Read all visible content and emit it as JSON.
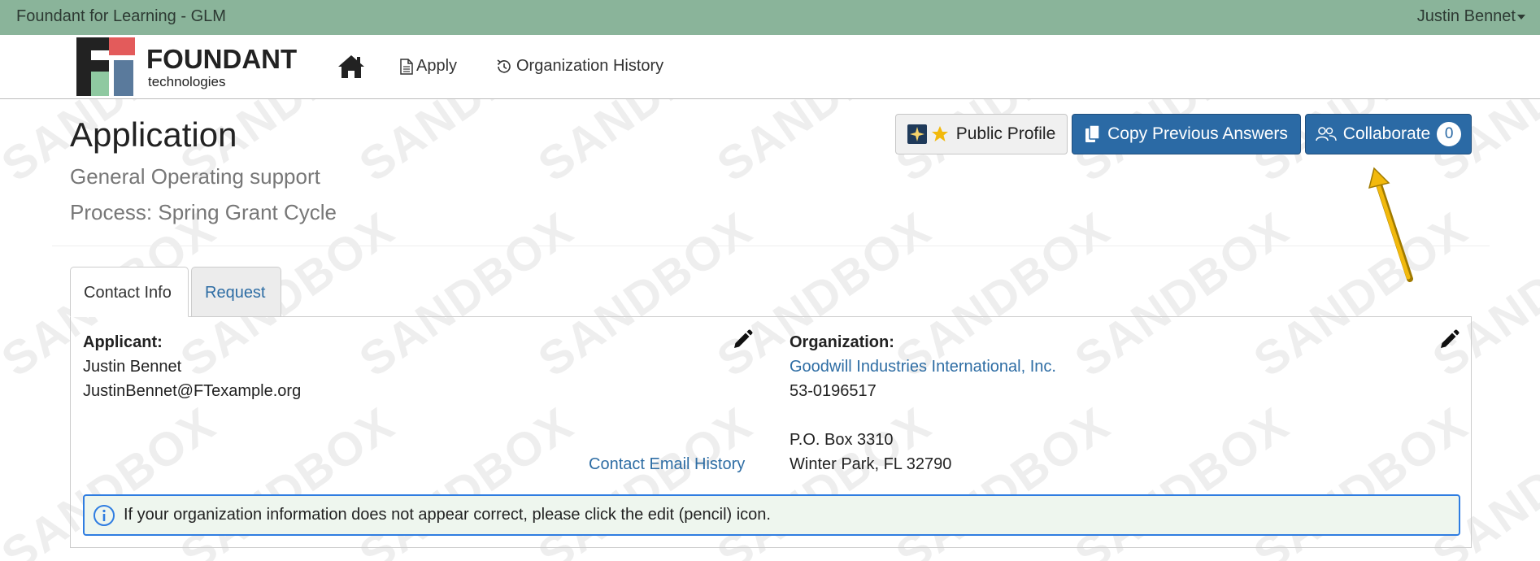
{
  "topbar": {
    "site_title": "Foundant for Learning - GLM",
    "user_name": "Justin Bennet"
  },
  "logo": {
    "name": "FOUNDANT",
    "tagline": "technologies"
  },
  "nav": {
    "home_icon": "home-icon",
    "apply_label": "Apply",
    "history_label": "Organization History"
  },
  "page": {
    "title": "Application",
    "subtitle": "General Operating support",
    "process": "Process: Spring Grant Cycle"
  },
  "actions": {
    "public_profile_label": "Public Profile",
    "copy_previous_label": "Copy Previous Answers",
    "collaborate_label": "Collaborate",
    "collaborate_count": "0"
  },
  "tabs": [
    {
      "label": "Contact Info",
      "active": true
    },
    {
      "label": "Request",
      "active": false
    }
  ],
  "applicant": {
    "label": "Applicant:",
    "name": "Justin Bennet",
    "email": "JustinBennet@FTexample.org",
    "email_history_link": "Contact Email History"
  },
  "organization": {
    "label": "Organization:",
    "name": "Goodwill Industries International, Inc.",
    "ein": "53-0196517",
    "address_line1": "P.O. Box 3310",
    "address_line2": "Winter Park, FL 32790"
  },
  "alert": {
    "message": "If your organization information does not appear correct, please click the edit (pencil) icon."
  },
  "watermark": "SANDBOX",
  "colors": {
    "topbar": "#8ab49a",
    "primary": "#2b6aa5",
    "link": "#2e6da4",
    "alert_border": "#2f7de1",
    "alert_bg": "#eef6ee",
    "annotation_arrow": "#f2b90c"
  }
}
